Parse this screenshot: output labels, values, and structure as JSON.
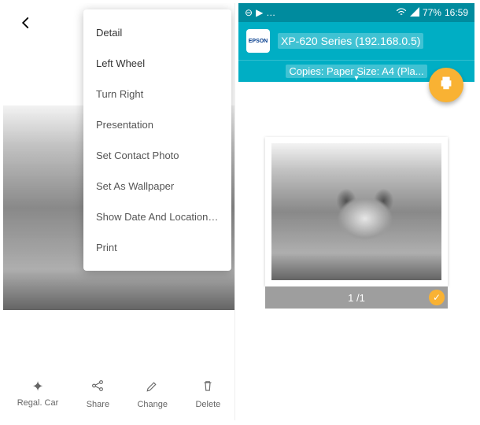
{
  "left": {
    "menu": {
      "items": [
        "Detail",
        "Left Wheel",
        "Turn Right",
        "Presentation",
        "Set Contact Photo",
        "Set As Wallpaper",
        "Show Date And Location Tag",
        "Print"
      ]
    },
    "bottombar": {
      "wand": "Regal. Car",
      "share": "Share",
      "change": "Change",
      "delete": "Delete"
    }
  },
  "right": {
    "status": {
      "battery": "77%",
      "time": "16:59"
    },
    "epson_label": "EPSON",
    "printer": "XP-620 Series (192.168.0.5)",
    "settings": "Copies: Paper Size: A4 (Pla...",
    "page_indicator": "1 /1"
  }
}
